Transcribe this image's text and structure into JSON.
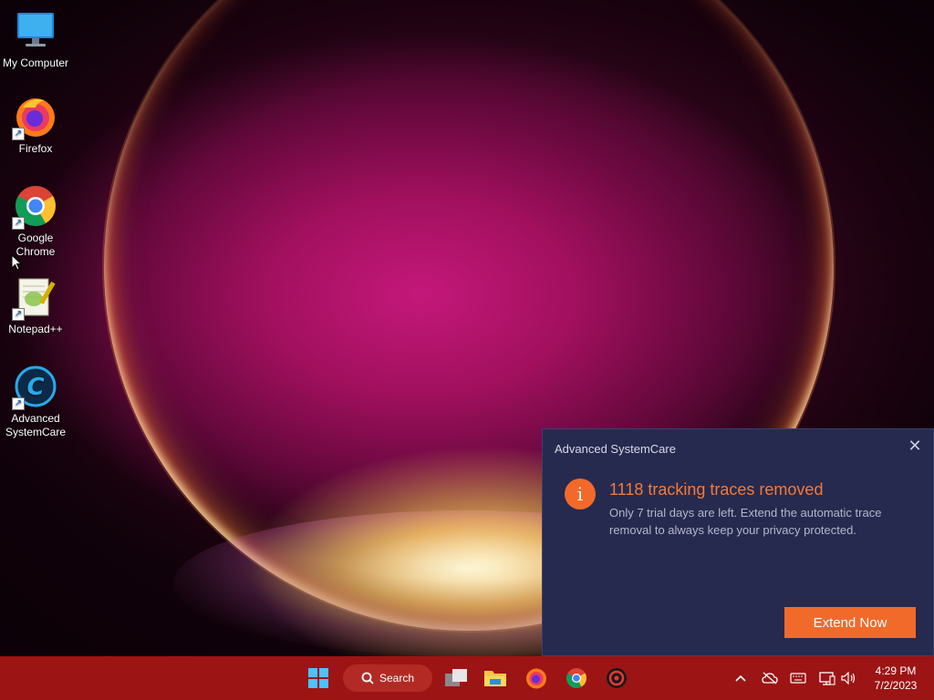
{
  "desktop": {
    "icons": [
      {
        "label": "My Computer",
        "icon": "monitor-icon"
      },
      {
        "label": "Firefox",
        "icon": "firefox-icon"
      },
      {
        "label": "Google Chrome",
        "icon": "chrome-icon"
      },
      {
        "label": "Notepad++",
        "icon": "notepadpp-icon"
      },
      {
        "label": "Advanced SystemCare",
        "icon": "advanced-systemcare-icon"
      }
    ]
  },
  "popup": {
    "title": "Advanced SystemCare",
    "headline": "1118 tracking traces removed",
    "body": "Only 7 trial days are left. Extend the automatic trace removal to always keep your privacy protected.",
    "button": "Extend Now",
    "info_glyph": "i",
    "close_glyph": "✕",
    "accent_color": "#f26a2a",
    "background_color": "#262a4e"
  },
  "taskbar": {
    "background_color": "#9c1414",
    "search_label": "Search",
    "apps": [
      "start-icon",
      "task-view-icon",
      "file-explorer-icon",
      "firefox-icon",
      "chrome-icon",
      "advanced-systemcare-icon"
    ],
    "tray": [
      "chevron-up-icon",
      "cloud-offline-icon",
      "keyboard-icon",
      "network-icon",
      "volume-icon"
    ],
    "time": "4:29 PM",
    "date": "7/2/2023"
  }
}
